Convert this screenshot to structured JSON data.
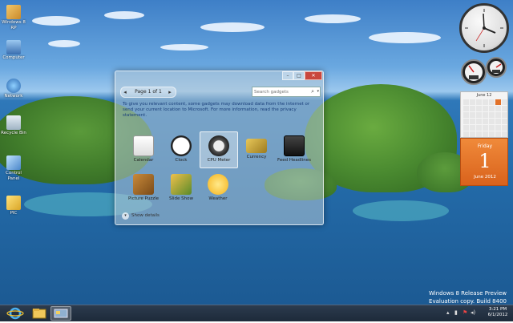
{
  "desktop_icons": [
    {
      "label": "Windows 8 RP"
    },
    {
      "label": "Computer"
    },
    {
      "label": "Network"
    },
    {
      "label": "Recycle Bin"
    },
    {
      "label": "Control Panel"
    },
    {
      "label": "PIC"
    }
  ],
  "gadget_window": {
    "page_label": "Page 1 of 1",
    "search_placeholder": "Search gadgets",
    "info_text": "To give you relevant content, some gadgets may download data from the internet or send your current location to Microsoft. For more information, read the privacy statement.",
    "show_details_label": "Show details",
    "gadgets": [
      {
        "label": "Calendar",
        "icon": "calendar-icon",
        "selected": false
      },
      {
        "label": "Clock",
        "icon": "clock-icon",
        "selected": false
      },
      {
        "label": "CPU Meter",
        "icon": "cpu-meter-icon",
        "selected": true
      },
      {
        "label": "Currency",
        "icon": "currency-icon",
        "selected": false
      },
      {
        "label": "Feed Headlines",
        "icon": "feed-headlines-icon",
        "selected": false
      },
      {
        "label": "Picture Puzzle",
        "icon": "picture-puzzle-icon",
        "selected": false
      },
      {
        "label": "Slide Show",
        "icon": "slide-show-icon",
        "selected": false
      },
      {
        "label": "Weather",
        "icon": "weather-icon",
        "selected": false
      }
    ]
  },
  "calendar_gadget": {
    "month_header": "June 12",
    "day_name": "Friday",
    "day_number": "1",
    "month_year": "June 2012",
    "accent_color": "#e2722a"
  },
  "watermark": {
    "line1": "Windows 8 Release Preview",
    "line2": "Evaluation copy. Build 8400"
  },
  "taskbar": {
    "time": "3:21 PM",
    "date": "6/1/2012"
  }
}
